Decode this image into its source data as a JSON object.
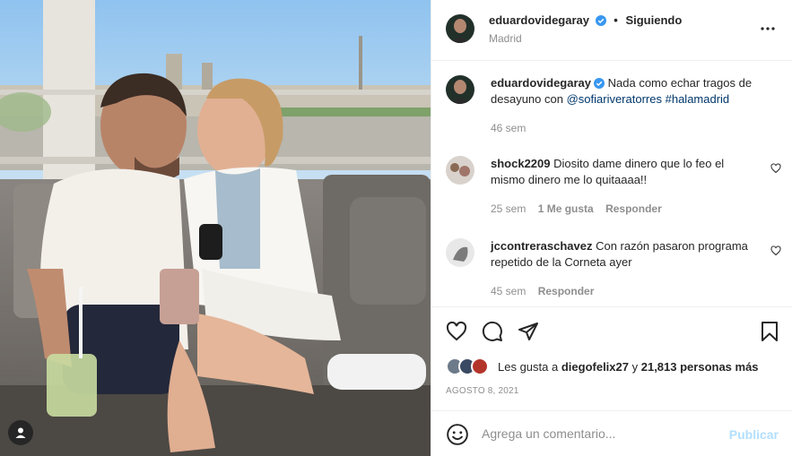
{
  "post": {
    "author": "eduardovidegaray",
    "separator": "•",
    "follow_status": "Siguiendo",
    "location": "Madrid",
    "verified_icon": "verified-badge-icon",
    "more_icon": "more-options-icon"
  },
  "caption": {
    "username": "eduardovidegaray",
    "text": "Nada como echar tragos de desayuno con",
    "mention": "@sofiariveratorres",
    "hashtag": "#halamadrid",
    "time": "46 sem"
  },
  "comments": [
    {
      "username": "shock2209",
      "text": "Diosito dame dinero que lo feo el mismo dinero me lo quitaaaa!!",
      "time": "25 sem",
      "likes_label": "1 Me gusta",
      "reply_label": "Responder"
    },
    {
      "username": "jccontreraschavez",
      "text": "Con razón pasaron programa repetido de la Corneta ayer",
      "time": "45 sem",
      "reply_label": "Responder"
    }
  ],
  "actions": {
    "icons": [
      "heart-icon",
      "comment-icon",
      "share-icon",
      "bookmark-icon"
    ]
  },
  "likes": {
    "prefix": "Les gusta a",
    "user": "diegofelix27",
    "connector": "y",
    "count": "21,813 personas más"
  },
  "date": "AGOSTO 8, 2021",
  "add_comment": {
    "placeholder": "Agrega un comentario...",
    "post_label": "Publicar"
  },
  "colors": {
    "verified": "#3897f0",
    "link": "#00376b",
    "muted": "#8e8e8e",
    "post_disabled": "#b2dffc"
  }
}
